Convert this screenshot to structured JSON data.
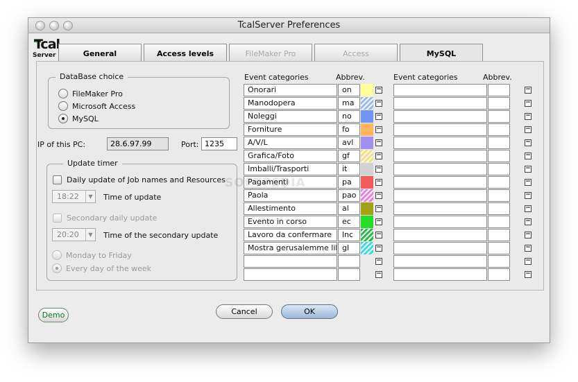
{
  "window": {
    "title": "TcalServer Preferences"
  },
  "logo": {
    "big": "Tcal",
    "small": "Server"
  },
  "tabs": [
    {
      "label": "General",
      "disabled": false
    },
    {
      "label": "Access levels",
      "disabled": false
    },
    {
      "label": "FileMaker Pro",
      "disabled": true
    },
    {
      "label": "Access",
      "disabled": true
    },
    {
      "label": "MySQL",
      "disabled": false
    }
  ],
  "database": {
    "title": "DataBase choice",
    "options": [
      "FileMaker Pro",
      "Microsoft Access",
      "MySQL"
    ],
    "selected": "MySQL"
  },
  "network": {
    "ip_label": "IP of this PC:",
    "ip_value": "28.6.97.99",
    "port_label": "Port:",
    "port_value": "1235"
  },
  "timer": {
    "title": "Update timer",
    "daily_label": "Daily update of Job names and Resources",
    "time_value": "18:22",
    "time_label": "Time of update",
    "secondary_label": "Secondary daily update",
    "secondary_time_value": "20:20",
    "secondary_time_label": "Time of the secondary update",
    "days_options": [
      "Monday to Friday",
      "Every day of the week"
    ],
    "days_selected": "Every day of the week"
  },
  "headers": {
    "left_categories": "Event categories",
    "left_abbrev": "Abbrev.",
    "right_categories": "Event categories",
    "right_abbrev": "Abbrev."
  },
  "categories": [
    {
      "name": "Onorari",
      "abbrev": "on",
      "color": "#ffff99",
      "pattern": "solid"
    },
    {
      "name": "Manodopera",
      "abbrev": "ma",
      "color": "#9ab8f0",
      "pattern": "hatch"
    },
    {
      "name": "Noleggi",
      "abbrev": "no",
      "color": "#6f96f5",
      "pattern": "solid"
    },
    {
      "name": "Forniture",
      "abbrev": "fo",
      "color": "#ffb65e",
      "pattern": "solid"
    },
    {
      "name": "A/V/L",
      "abbrev": "avl",
      "color": "#a38ff2",
      "pattern": "solid"
    },
    {
      "name": "Grafica/Foto",
      "abbrev": "gf",
      "color": "#f1e27a",
      "pattern": "hatch"
    },
    {
      "name": "Imballi/Trasporti",
      "abbrev": "it",
      "color": "#d2d2d2",
      "pattern": "solid"
    },
    {
      "name": "Pagamenti",
      "abbrev": "pa",
      "color": "#f25a5a",
      "pattern": "solid"
    },
    {
      "name": "Paola",
      "abbrev": "pao",
      "color": "#f07ae6",
      "pattern": "hatch"
    },
    {
      "name": "Allestimento",
      "abbrev": "al",
      "color": "#a3a112",
      "pattern": "solid"
    },
    {
      "name": "Evento in corso",
      "abbrev": "ec",
      "color": "#22dd22",
      "pattern": "solid"
    },
    {
      "name": "Lavoro da confermare",
      "abbrev": "lnc",
      "color": "#1fbf3f",
      "pattern": "hatch"
    },
    {
      "name": "Mostra gerusalemme lib",
      "abbrev": "gl",
      "color": "#30dde6",
      "pattern": "hatch"
    },
    {
      "name": "",
      "abbrev": "",
      "color": "",
      "pattern": "none"
    },
    {
      "name": "",
      "abbrev": "",
      "color": "",
      "pattern": "none"
    }
  ],
  "right_rows": 15,
  "buttons": {
    "demo": "Demo",
    "cancel": "Cancel",
    "ok": "OK"
  },
  "watermark": "SOFTPEDIA"
}
